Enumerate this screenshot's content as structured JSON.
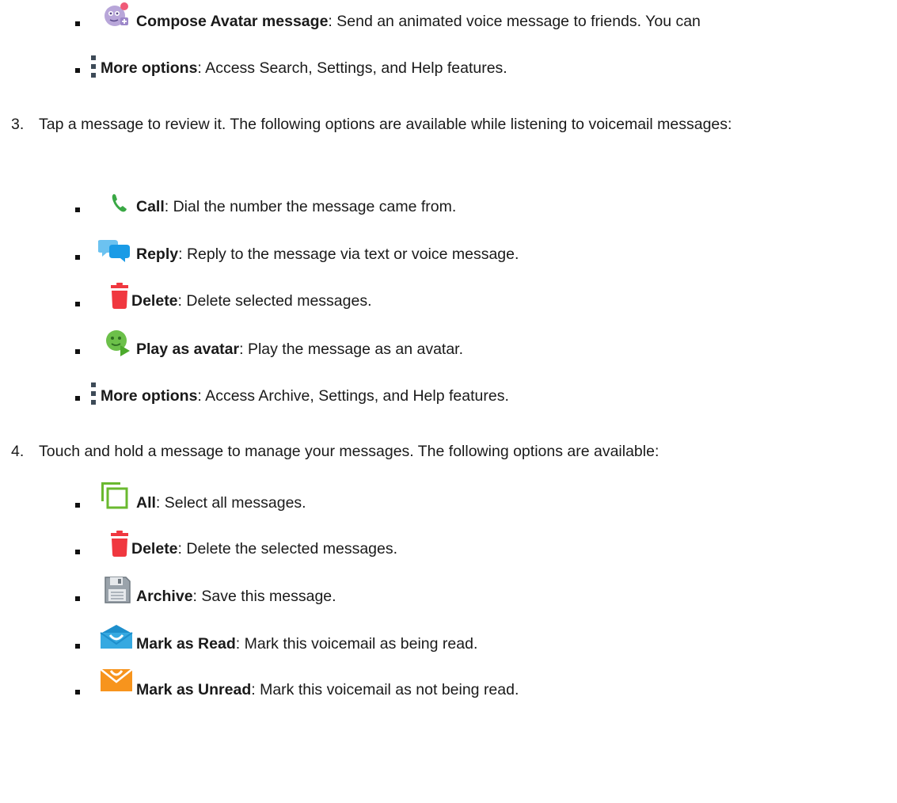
{
  "section_a": {
    "items": [
      {
        "icon": "avatar-compose-icon",
        "term": "Compose Avatar message",
        "desc": ": Send an animated voice message to friends. You can"
      },
      {
        "icon": "more-options-icon",
        "term": "More options",
        "desc": ": Access Search, Settings, and Help features."
      }
    ]
  },
  "step3": {
    "number": "3.",
    "text": "Tap a message to review it. The following options are available while listening to voicemail messages:",
    "items": [
      {
        "icon": "phone-call-icon",
        "term": "Call",
        "desc": ": Dial the number the message came from."
      },
      {
        "icon": "reply-chat-icon",
        "term": "Reply",
        "desc": ": Reply to the message via text or voice message."
      },
      {
        "icon": "trash-icon",
        "term": "Delete",
        "desc": ": Delete selected messages."
      },
      {
        "icon": "play-avatar-icon",
        "term": "Play as avatar",
        "desc": ": Play the message as an avatar."
      },
      {
        "icon": "more-options-icon",
        "term": "More options",
        "desc": ": Access Archive, Settings, and Help features."
      }
    ]
  },
  "step4": {
    "number": "4.",
    "text": "Touch and hold a message to manage your messages. The following options are available:",
    "items": [
      {
        "icon": "select-all-icon",
        "term": "All",
        "desc": ": Select all messages."
      },
      {
        "icon": "trash-icon",
        "term": "Delete",
        "desc": ": Delete the selected messages."
      },
      {
        "icon": "archive-save-icon",
        "term": "Archive",
        "desc": ": Save this message."
      },
      {
        "icon": "mark-read-icon",
        "term": "Mark as Read",
        "desc": ": Mark this voicemail as being read."
      },
      {
        "icon": "mark-unread-icon",
        "term": "Mark as Unread",
        "desc": ": Mark this voicemail as not being read."
      }
    ]
  },
  "colors": {
    "call_green": "#3aa845",
    "reply_blue": "#1a9be6",
    "delete_red": "#f0373f",
    "avatar_green": "#6cc04a",
    "select_green": "#6ab92f",
    "mark_read_blue": "#36a9e1",
    "mark_unread_orange": "#f7941d",
    "more_dots": "#3d4a57"
  }
}
